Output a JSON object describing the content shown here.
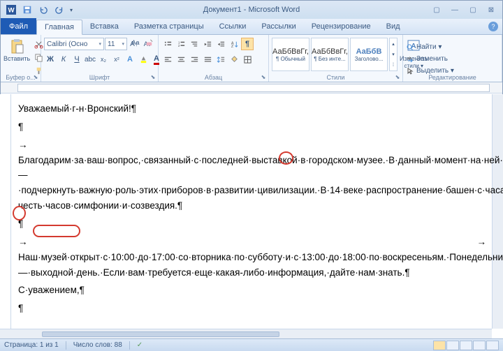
{
  "app": {
    "title": "Документ1 - Microsoft Word"
  },
  "qat": {
    "word": "W",
    "save": "save",
    "undo": "undo",
    "redo": "redo"
  },
  "tabs": {
    "file": "Файл",
    "items": [
      "Главная",
      "Вставка",
      "Разметка страницы",
      "Ссылки",
      "Рассылки",
      "Рецензирование",
      "Вид"
    ],
    "active_index": 0
  },
  "ribbon": {
    "clipboard": {
      "paste": "Вставить",
      "label": "Буфер о..."
    },
    "font": {
      "name": "Calibri (Осно",
      "size": "11",
      "bold": "Ж",
      "italic": "К",
      "underline": "Ч",
      "label": "Шрифт"
    },
    "paragraph": {
      "label": "Абзац"
    },
    "styles": {
      "label": "Стили",
      "items": [
        {
          "preview": "АаБбВвГг,",
          "name": "¶ Обычный"
        },
        {
          "preview": "АаБбВвГг,",
          "name": "¶ Без инте..."
        },
        {
          "preview": "АаБбВ",
          "name": "Заголово..."
        }
      ],
      "change": "Изменить",
      "change2": "стили ▾"
    },
    "editing": {
      "find": "Найти ▾",
      "replace": "Заменить",
      "select": "Выделить ▾",
      "label": "Редактирование"
    }
  },
  "document": {
    "p1": "Уважаемый·г-н·Вронский!¶",
    "p2": "¶",
    "p3_pre": "→     Благодарим·за·ваш·вопрос,·связанный·с·последней·выставкой·в·городском·музее.·В·данный·момент·на·ней·действительно·демонстрируются·часы.··Одна·из·задач·выставки·—·подчеркнуть·важную·роль·этих·приборов·в·развитии·цивилизации.·В·14·веке·распространение·башен·с·часами·было·признаком·развития·мышления,·ориентированного·на·бизнес.·Люди·называли·в честь·часов·симфонии·и·созвездия.¶",
    "p4": "¶",
    "p5": "     →     →     Наш·музей·открыт·с·10:00·до·17:00·со·вторника·по·субботу·и·с·13:00·до·18:00·по·воскресеньям.·Понедельник·—·выходной·день.·Если·вам·требуется·еще·какая-либо·информация,·дайте·нам·знать.¶",
    "p6": "С·уважением,¶",
    "p7": "¶"
  },
  "status": {
    "page": "Страница: 1 из 1",
    "words": "Число слов: 88",
    "lang_icon": "✓"
  }
}
